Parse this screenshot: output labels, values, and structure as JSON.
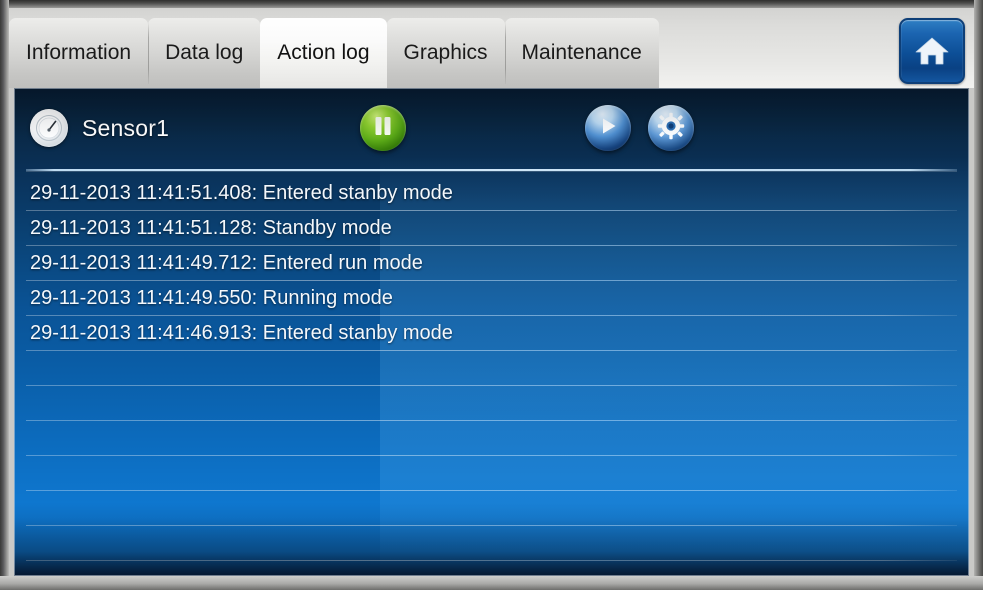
{
  "window": {
    "accent_blue": "#0a5396",
    "tab_bar_bg": "#dcdcda",
    "home_button_blue": "#1b64b0"
  },
  "tabs": [
    {
      "label": "Information",
      "active": false
    },
    {
      "label": "Data log",
      "active": false
    },
    {
      "label": "Action log",
      "active": true
    },
    {
      "label": "Graphics",
      "active": false
    },
    {
      "label": "Maintenance",
      "active": false
    }
  ],
  "home_button": {
    "icon": "home-icon",
    "label": "Home"
  },
  "toolbar": {
    "sensor_icon": "gauge-icon",
    "sensor_label": "Sensor1",
    "pause_button": {
      "icon": "pause-icon",
      "label": "Pause",
      "color": "#5aa817"
    },
    "play_button": {
      "icon": "play-icon",
      "label": "Play",
      "color": "#16437e"
    },
    "settings_button": {
      "icon": "gear-icon",
      "label": "Settings",
      "color": "#1a4a84"
    }
  },
  "log": {
    "entries": [
      "29-11-2013 11:41:51.408: Entered stanby mode",
      "29-11-2013 11:41:51.128: Standby mode",
      "29-11-2013 11:41:49.712: Entered run mode",
      "29-11-2013 11:41:49.550: Running mode",
      "29-11-2013 11:41:46.913: Entered stanby mode"
    ],
    "empty_row_count": 6
  }
}
